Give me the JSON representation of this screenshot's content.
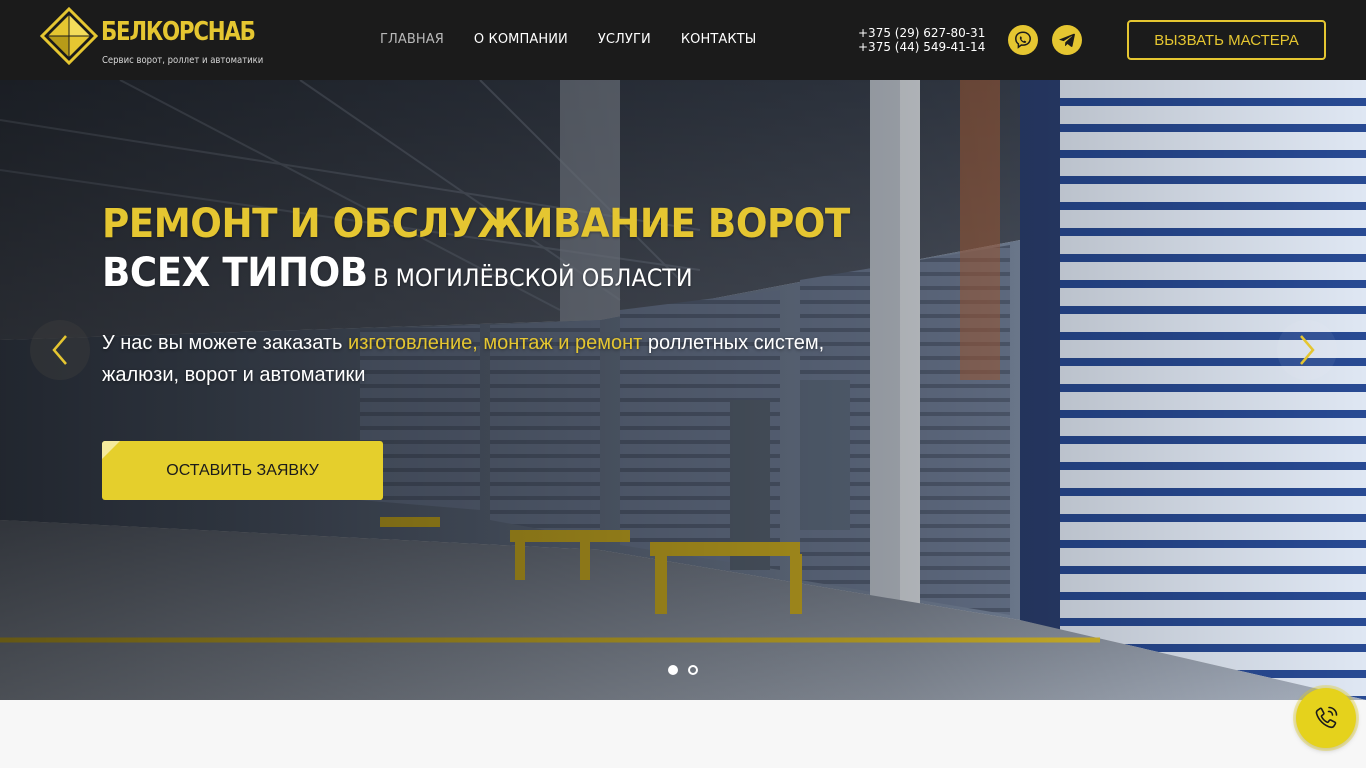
{
  "header": {
    "logo": {
      "title": "БЕЛКОРСНАБ",
      "subtitle": "Сервис ворот, роллет и автоматики"
    },
    "nav": [
      {
        "label": "ГЛАВНАЯ",
        "active": true
      },
      {
        "label": "О КОМПАНИИ",
        "active": false
      },
      {
        "label": "УСЛУГИ",
        "active": false
      },
      {
        "label": "КОНТАКТЫ",
        "active": false
      }
    ],
    "phones": [
      "+375 (29) 627-80-31",
      "+375 (44) 549-41-14"
    ],
    "messengers": [
      {
        "icon": "viber-icon"
      },
      {
        "icon": "telegram-icon"
      }
    ],
    "call_button": "ВЫЗВАТЬ МАСТЕРА"
  },
  "hero": {
    "title_line1": "РЕМОНТ И ОБСЛУЖИВАНИЕ ВОРОТ",
    "title_line2_big": "ВСЕХ ТИПОВ",
    "title_line2_small": "В МОГИЛЁВСКОЙ ОБЛАСТИ",
    "text_before": "У нас вы можете заказать ",
    "text_highlight": "изготовление, монтаж и ремонт",
    "text_after": " роллетных систем, жалюзи, ворот и автоматики",
    "cta_button": "ОСТАВИТЬ ЗАЯВКУ",
    "slider": {
      "slides": 2,
      "active_slide": 1,
      "prev_icon": "chevron-left-icon",
      "next_icon": "chevron-right-icon"
    }
  },
  "floating_call": {
    "icon": "phone-ringing-icon"
  },
  "colors": {
    "accent": "#e5c631",
    "header_bg": "#1b1b1b",
    "button_bg": "#e5cf2c",
    "text_light": "#ffffff"
  }
}
